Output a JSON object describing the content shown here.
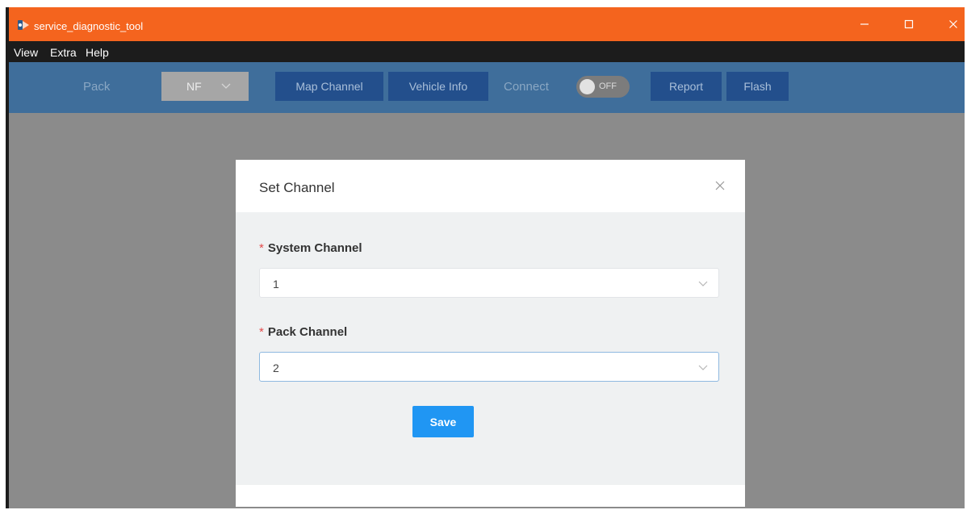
{
  "window": {
    "title": "service_diagnostic_tool",
    "accent_color": "#f4641e"
  },
  "menu": {
    "items": [
      "View",
      "Extra",
      "Help"
    ]
  },
  "toolbar": {
    "pack_label": "Pack",
    "pack_value": "NF",
    "map_channel_label": "Map Channel",
    "vehicle_info_label": "Vehicle Info",
    "connect_label": "Connect",
    "connect_toggle_text": "OFF",
    "report_label": "Report",
    "flash_label": "Flash"
  },
  "modal": {
    "title": "Set Channel",
    "system_channel": {
      "label": "System Channel",
      "value": "1"
    },
    "pack_channel": {
      "label": "Pack Channel",
      "value": "2"
    },
    "save_label": "Save",
    "save_color": "#2096f3"
  }
}
